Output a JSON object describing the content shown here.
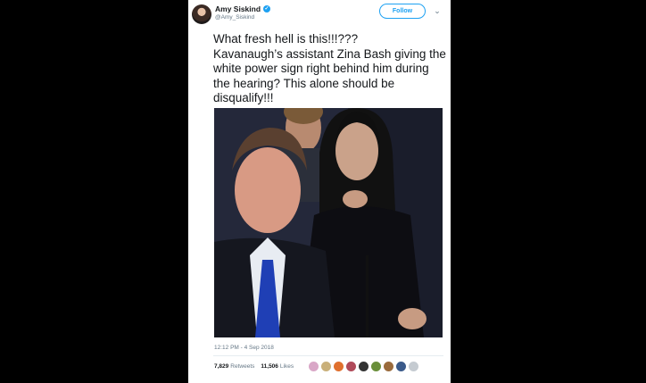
{
  "tweet": {
    "display_name": "Amy Siskind",
    "handle": "@Amy_Siskind",
    "follow_label": "Follow",
    "verified_glyph": "✓",
    "chevron_glyph": "⌄",
    "text": "What fresh hell is this!!!???\nKavanaugh’s assistant Zina Bash giving the white power sign right behind him during the hearing?  This alone should be disqualify!!!",
    "timestamp": "12:12 PM - 4 Sep 2018",
    "retweets_count": "7,829",
    "retweets_label": "Retweets",
    "likes_count": "11,506",
    "likes_label": "Likes",
    "liker_avatar_colors": [
      "#d9a7c7",
      "#c9b07a",
      "#e0702e",
      "#b04a5a",
      "#333333",
      "#6a8f3a",
      "#9a6b3c",
      "#3a5a8a",
      "#c5cbd1"
    ]
  },
  "colors": {
    "accent": "#1da1f2",
    "text": "#14171a",
    "muted": "#657786",
    "background": "#000000"
  },
  "icons": {
    "verified": "verified-badge-icon",
    "caret": "chevron-down-icon"
  }
}
